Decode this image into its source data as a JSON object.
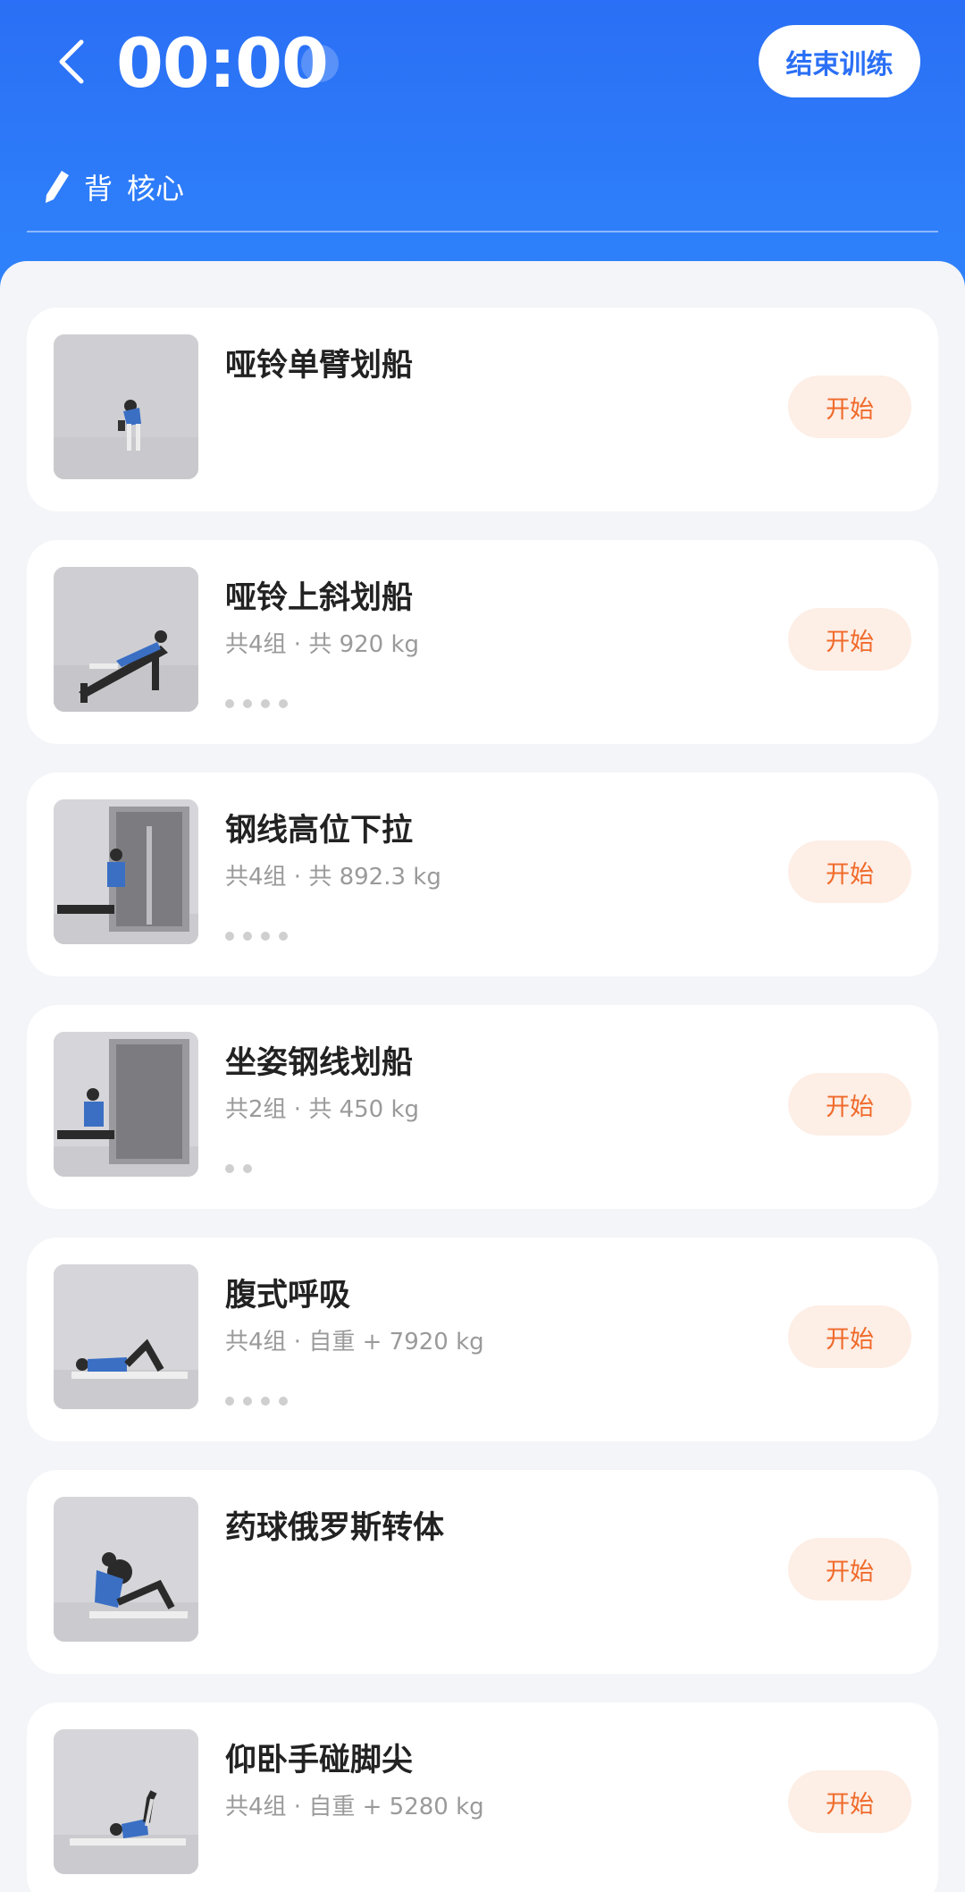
{
  "header": {
    "timer": "00:00",
    "end_label": "结束训练",
    "tags": [
      "背",
      "核心"
    ]
  },
  "exercises": [
    {
      "name": "哑铃单臂划船",
      "meta": "",
      "sets_dots": 0,
      "start_label": "开始"
    },
    {
      "name": "哑铃上斜划船",
      "meta": "共4组 · 共 920 kg",
      "sets_dots": 4,
      "start_label": "开始"
    },
    {
      "name": "钢线高位下拉",
      "meta": "共4组 · 共 892.3 kg",
      "sets_dots": 4,
      "start_label": "开始"
    },
    {
      "name": "坐姿钢线划船",
      "meta": "共2组 · 共 450 kg",
      "sets_dots": 2,
      "start_label": "开始"
    },
    {
      "name": "腹式呼吸",
      "meta": "共4组 · 自重 + 7920 kg",
      "sets_dots": 4,
      "start_label": "开始"
    },
    {
      "name": "药球俄罗斯转体",
      "meta": "",
      "sets_dots": 0,
      "start_label": "开始"
    },
    {
      "name": "仰卧手碰脚尖",
      "meta": "共4组 · 自重 + 5280 kg",
      "sets_dots": 0,
      "start_label": "开始"
    }
  ],
  "colors": {
    "header_blue": "#2a6ff5",
    "start_text": "#f06a2a",
    "start_bg": "#fdeee6"
  }
}
